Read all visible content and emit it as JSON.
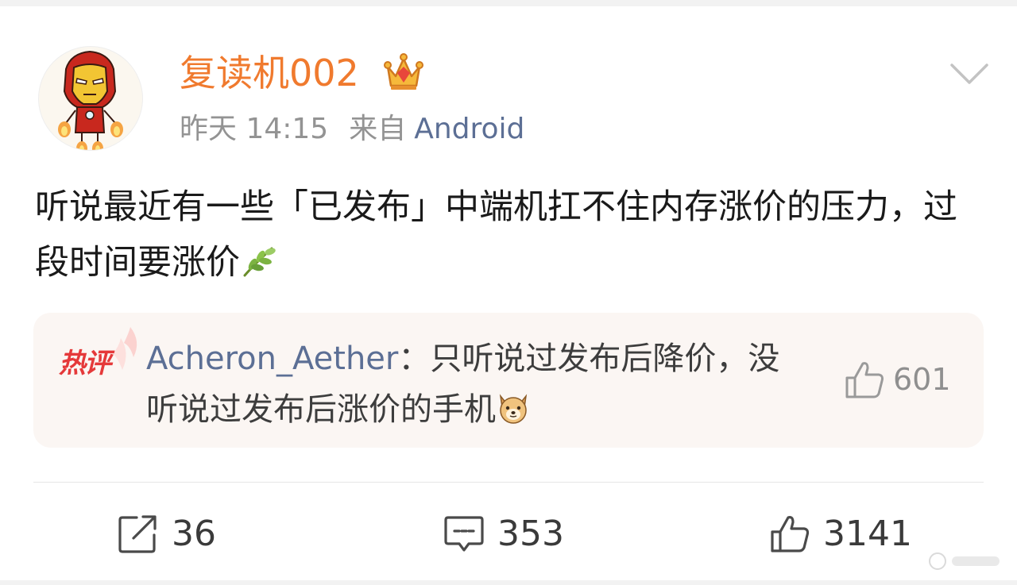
{
  "post": {
    "username": "复读机002",
    "time": "昨天 14:15",
    "source_label": "来自",
    "source": "Android",
    "content": "听说最近有一些「已发布」中端机扛不住内存涨价的压力，过段时间要涨价"
  },
  "hot_comment": {
    "badge": "热评",
    "user": "Acheron_Aether",
    "separator": "：",
    "text": "只听说过发布后降价，没听说过发布后涨价的手机",
    "likes": "601"
  },
  "actions": {
    "share_count": "36",
    "comment_count": "353",
    "like_count": "3141"
  },
  "icons": {
    "avatar": "iron-man-avatar",
    "vip": "crown-icon",
    "more": "chevron-down-icon",
    "leaf": "leaf-emoji",
    "dog": "doge-emoji",
    "share": "share-icon",
    "comment": "comment-icon",
    "like": "thumbs-up-icon"
  },
  "colors": {
    "username": "#f07a2e",
    "link": "#5c6f95",
    "badge": "#e5393a",
    "muted": "#939393"
  }
}
